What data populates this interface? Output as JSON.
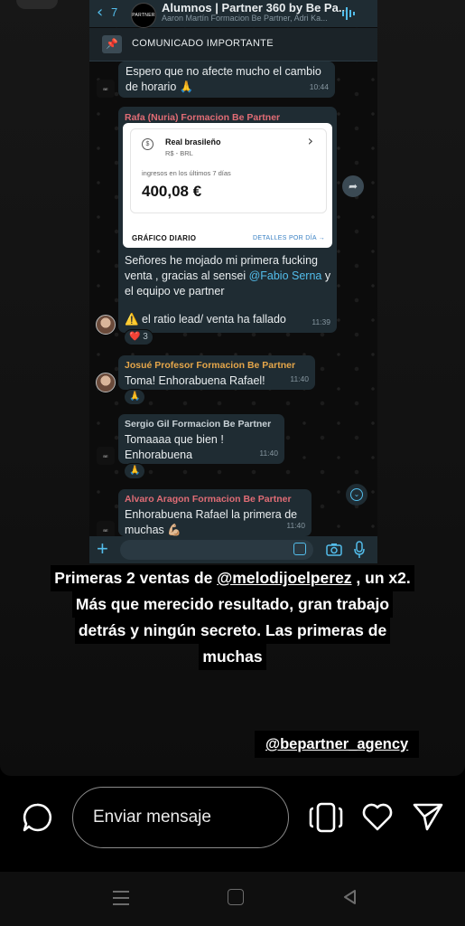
{
  "chat": {
    "back_count": "7",
    "group_avatar_text": "PARTNER",
    "group_name": "Alumnos | Partner 360 by Be Pa...",
    "group_members": "Aaron Martín Formacion Be Partner, Adri Ka...",
    "pinned": "COMUNICADO IMPORTANTE",
    "msg1_text": "Espero que no afecte mucho el cambio\nde horario 🙏",
    "msg1_time": "10:44",
    "msg2_sender": "Rafa (Nuria) Formacion Be Partner",
    "card": {
      "currency_name": "Real brasileño",
      "currency_code": "R$ - BRL",
      "income_label": "ingresos en los últimos 7 días",
      "income_value": "400,08 €",
      "daily_label": "GRÁFICO DIARIO",
      "details_link": "DETALLES POR DÍA →"
    },
    "msg2_text_a": "Señores he mojado mi primera fucking venta , gracias al sensei ",
    "msg2_mention": "@Fabio Serna",
    "msg2_text_b": " y el equipo ve partner",
    "msg2_text_c": "⚠️ el ratio lead/ venta ha fallado",
    "msg2_time": "11:39",
    "msg2_reaction": "❤️ 3",
    "msg3_sender": "Josué Profesor Formacion Be Partner",
    "msg3_text": "Toma! Enhorabuena Rafael!",
    "msg3_time": "11:40",
    "msg3_reaction": "🙏",
    "msg4_sender": "Sergio Gil Formacion Be Partner",
    "msg4_text": "Tomaaaa que bien !\nEnhorabuena",
    "msg4_time": "11:40",
    "msg4_reaction": "🙏",
    "msg5_sender": "Alvaro Aragon Formacion Be Partner",
    "msg5_text": "Enhorabuena Rafael la primera de\nmuchas 💪🏼",
    "msg5_time": "11:40"
  },
  "caption": {
    "line1_a": "Primeras 2 ventas de ",
    "line1_mention": "@melodijoelperez",
    "line1_b": " , un x2.",
    "line2": "Más que merecido resultado, gran trabajo",
    "line3": "detrás y ningún secreto. Las primeras de",
    "line4": "muchas"
  },
  "tag": "@bepartner_agency",
  "reply": {
    "placeholder": "Enviar mensaje"
  },
  "colors": {
    "accent": "#53bdeb",
    "sender_rafa": "#e06c75",
    "sender_josue": "#e5a64a",
    "sender_sergio": "#c8d1d6",
    "sender_alvaro": "#e06c75"
  },
  "icons": [
    "back-arrow-icon",
    "audio-wave-icon",
    "pin-icon",
    "forward-icon",
    "scroll-down-icon",
    "plus-icon",
    "sticker-icon",
    "camera-icon",
    "mic-icon",
    "chat-bubble-icon",
    "stack-icon",
    "heart-icon",
    "send-icon",
    "nav-menu-icon",
    "nav-home-icon",
    "nav-back-icon"
  ]
}
